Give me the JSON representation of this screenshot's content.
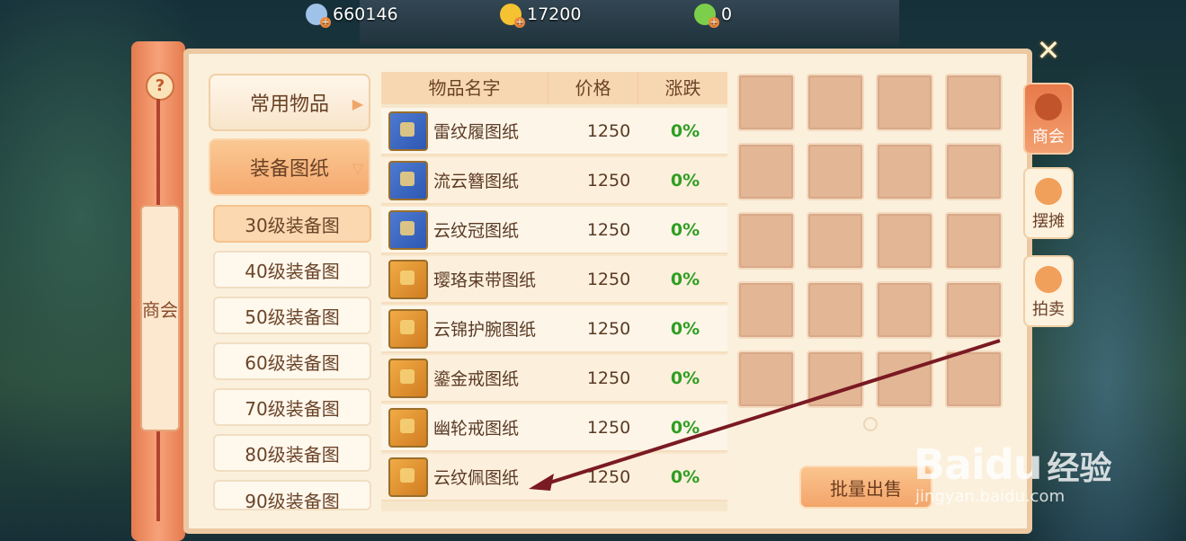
{
  "currencies": [
    {
      "value": "660146",
      "icon": "silver-coin-icon",
      "color": "#9fc2e8"
    },
    {
      "value": "17200",
      "icon": "gold-coin-icon",
      "color": "#f5c232"
    },
    {
      "value": "0",
      "icon": "jade-coin-icon",
      "color": "#7ccf4a"
    }
  ],
  "scroll": {
    "help": "?",
    "label": "商会"
  },
  "categories": {
    "common": "常用物品",
    "equipment": "装备图纸",
    "sub": [
      "30级装备图",
      "40级装备图",
      "50级装备图",
      "60级装备图",
      "70级装备图",
      "80级装备图",
      "90级装备图"
    ]
  },
  "table": {
    "headers": [
      "物品名字",
      "价格",
      "涨跌"
    ],
    "rows": [
      {
        "name": "雷纹履图纸",
        "price": "1250",
        "change": "0%",
        "icon": "blue-book-icon"
      },
      {
        "name": "流云簪图纸",
        "price": "1250",
        "change": "0%",
        "icon": "blue-book-icon"
      },
      {
        "name": "云纹冠图纸",
        "price": "1250",
        "change": "0%",
        "icon": "blue-book-icon"
      },
      {
        "name": "璎珞束带图纸",
        "price": "1250",
        "change": "0%",
        "icon": "gold-book-icon"
      },
      {
        "name": "云锦护腕图纸",
        "price": "1250",
        "change": "0%",
        "icon": "gold-book-icon"
      },
      {
        "name": "鎏金戒图纸",
        "price": "1250",
        "change": "0%",
        "icon": "gold-book-icon"
      },
      {
        "name": "幽轮戒图纸",
        "price": "1250",
        "change": "0%",
        "icon": "gold-book-icon"
      },
      {
        "name": "云纹佩图纸",
        "price": "1250",
        "change": "0%",
        "icon": "gold-book-icon"
      }
    ]
  },
  "bulk_sell": "批量出售",
  "tabs": [
    {
      "label": "商会",
      "active": true
    },
    {
      "label": "摆摊",
      "active": false
    },
    {
      "label": "拍卖",
      "active": false
    }
  ],
  "watermark": {
    "brand": "Baidu",
    "cn": "经验",
    "url": "jingyan.baidu.com"
  }
}
